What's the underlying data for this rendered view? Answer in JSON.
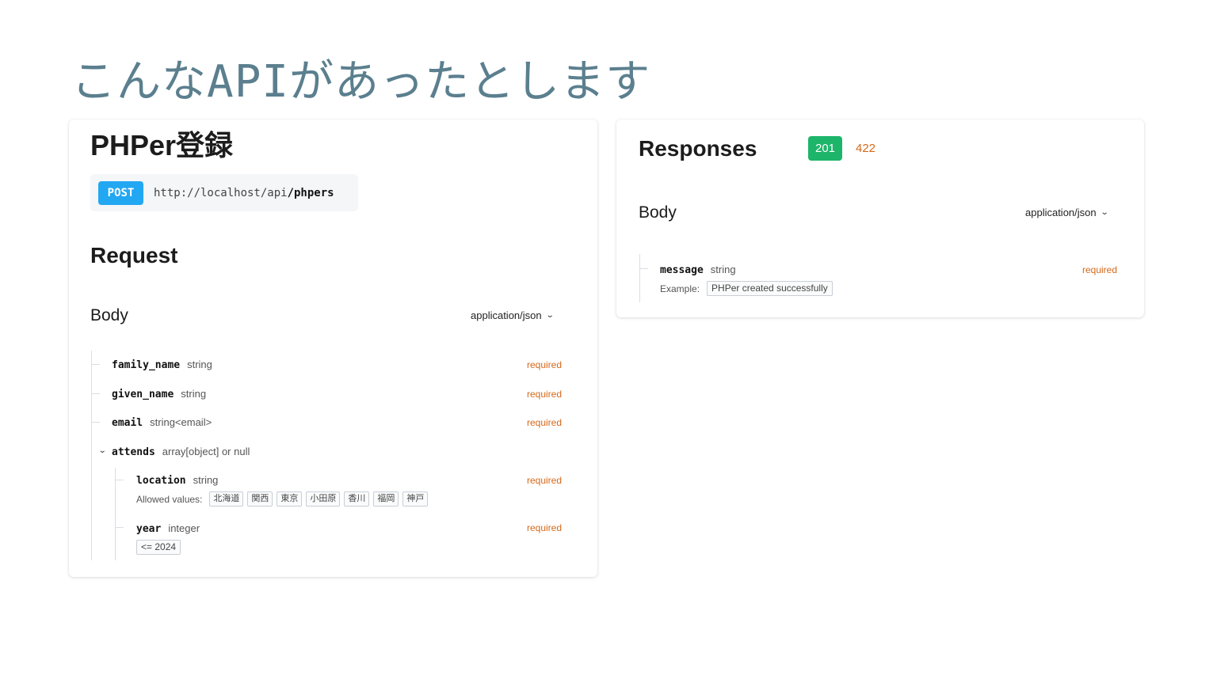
{
  "slide_title": "こんなAPIがあったとします",
  "operation": {
    "title": "PHPer登録",
    "method": "POST",
    "url_base": "http://localhost/api",
    "url_path": "/phpers"
  },
  "request": {
    "heading": "Request",
    "body_label": "Body",
    "mime": "application/json",
    "fields": [
      {
        "name": "family_name",
        "type": "string",
        "required": "required"
      },
      {
        "name": "given_name",
        "type": "string",
        "required": "required"
      },
      {
        "name": "email",
        "type": "string<email>",
        "required": "required"
      },
      {
        "name": "attends",
        "type": "array[object] or null"
      },
      {
        "name": "location",
        "type": "string",
        "required": "required",
        "allowed_label": "Allowed values:",
        "allowed_values": [
          "北海道",
          "関西",
          "東京",
          "小田原",
          "香川",
          "福岡",
          "神戸"
        ]
      },
      {
        "name": "year",
        "type": "integer",
        "required": "required",
        "constraint": "<= 2024"
      }
    ]
  },
  "responses": {
    "heading": "Responses",
    "codes": [
      "201",
      "422"
    ],
    "colors": {
      "success": "#1db56a",
      "error": "#d4691b",
      "method": "#22a7f2"
    },
    "body_label": "Body",
    "mime": "application/json",
    "field": {
      "name": "message",
      "type": "string",
      "required": "required",
      "example_label": "Example:",
      "example": "PHPer created successfully"
    }
  },
  "icons": {
    "dropdown": "chevron-down-icon",
    "expand": "chevron-down-icon"
  }
}
